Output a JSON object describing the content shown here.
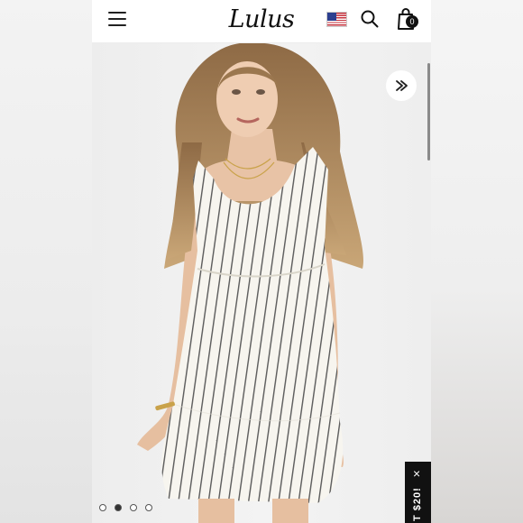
{
  "header": {
    "brand": "Lulus",
    "menu_icon": "hamburger-menu-icon",
    "flag_icon": "us-flag-icon",
    "search_icon": "search-icon",
    "bag_icon": "shopping-bag-icon",
    "bag_count": "0"
  },
  "gallery": {
    "share_icon": "share-icon",
    "dot_count": 4,
    "active_dot": 2
  },
  "promo": {
    "text": "T $20!",
    "close_label": "×"
  },
  "colors": {
    "header_bg": "#ffffff",
    "dress": "#f7f5ef",
    "stripe": "#5a5a5a",
    "hair": "#b48d62",
    "promo_bg": "#111111"
  }
}
